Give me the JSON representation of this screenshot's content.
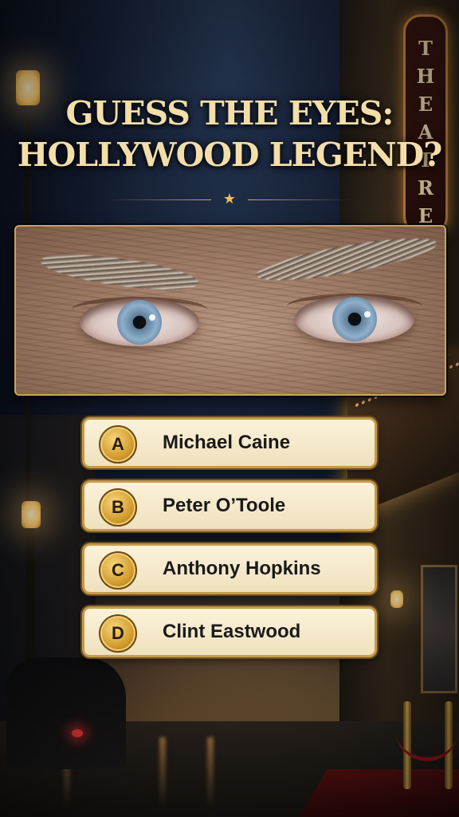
{
  "quiz": {
    "title_line1": "GUESS THE EYES:",
    "title_line2": "HOLLYWOOD LEGEND?",
    "divider_icon": "star-icon",
    "divider_glyph": "★"
  },
  "backdrop": {
    "marquee_sign": "THEATRE"
  },
  "answers": [
    {
      "letter": "A",
      "label": "Michael Caine"
    },
    {
      "letter": "B",
      "label": "Peter O’Toole"
    },
    {
      "letter": "C",
      "label": "Anthony Hopkins"
    },
    {
      "letter": "D",
      "label": "Clint Eastwood"
    }
  ],
  "colors": {
    "title_gold": "#f3deaa",
    "accent_gold": "#c59a4a",
    "card_cream": "#fbf2da",
    "badge_gold": "#d19a2c"
  }
}
